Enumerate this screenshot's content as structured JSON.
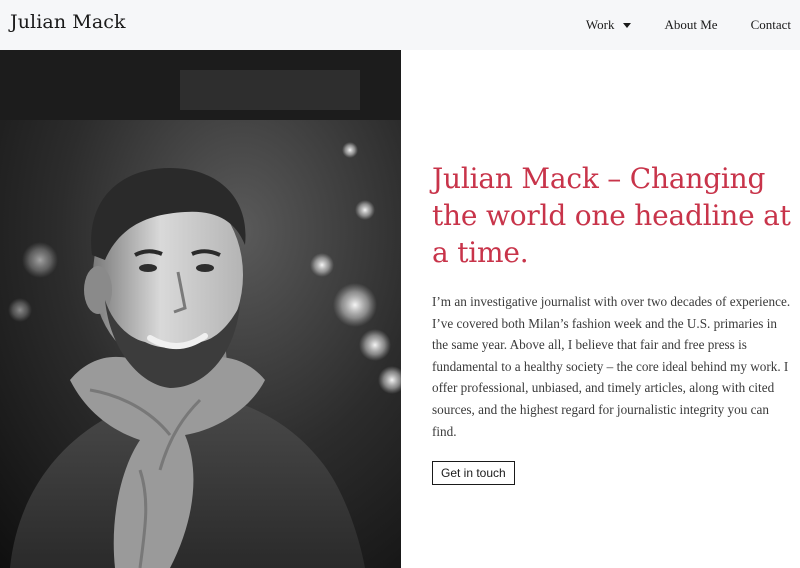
{
  "header": {
    "site_title": "Julian Mack",
    "nav": [
      {
        "label": "Work",
        "has_dropdown": true
      },
      {
        "label": "About Me",
        "has_dropdown": false
      },
      {
        "label": "Contact",
        "has_dropdown": false
      }
    ]
  },
  "hero": {
    "image_alt": "Black and white portrait of Julian Mack wearing a scarf",
    "headline": "Julian Mack – Changing the world one headline at a time.",
    "bio": "I’m an investigative journalist with over two decades of experience. I’ve covered both Milan’s fashion week and the U.S. primaries in the same year. Above all, I believe that fair and free press is fundamental to a healthy society – the core ideal behind my work. I offer professional, unbiased, and timely articles, along with cited sources, and the highest regard for journalistic integrity you can find.",
    "cta_label": "Get in touch"
  },
  "colors": {
    "accent": "#c8344a",
    "header_bg": "#f6f7f9",
    "text": "#3a3a3a"
  }
}
